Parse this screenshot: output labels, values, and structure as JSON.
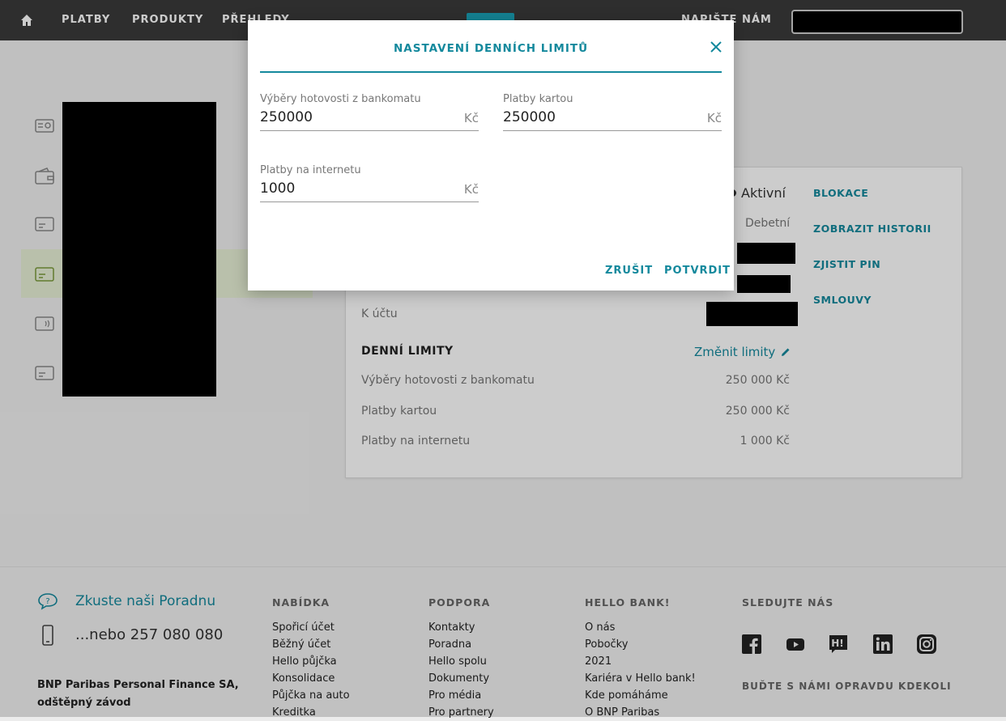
{
  "nav": {
    "items": [
      "PLATBY",
      "PRODUKTY",
      "PŘEHLEDY"
    ],
    "right_label": "NAPIŠTE NÁM"
  },
  "card_panel": {
    "status": "Aktivní",
    "type": "Debetní",
    "account_label": "K účtu",
    "actions": [
      "BLOKACE",
      "ZOBRAZIT HISTORII",
      "ZJISTIT PIN",
      "SMLOUVY"
    ],
    "limits_title": "DENNÍ LIMITY",
    "change_limits": "Změnit limity",
    "limits": [
      {
        "label": "Výběry hotovosti z bankomatu",
        "value": "250 000 Kč"
      },
      {
        "label": "Platby kartou",
        "value": "250 000 Kč"
      },
      {
        "label": "Platby na internetu",
        "value": "1 000 Kč"
      }
    ]
  },
  "modal": {
    "title": "NASTAVENÍ DENNÍCH LIMITŮ",
    "fields": [
      {
        "label": "Výběry hotovosti z bankomatu",
        "value": "250000",
        "unit": "Kč"
      },
      {
        "label": "Platby kartou",
        "value": "250000",
        "unit": "Kč"
      },
      {
        "label": "Platby na internetu",
        "value": "1000",
        "unit": "Kč"
      }
    ],
    "cancel_label": "ZRUŠIT",
    "confirm_label": "POTVRDIT"
  },
  "footer": {
    "help_link": "Zkuste naši Poradnu",
    "phone": "...nebo 257 080 080",
    "company_line1": "BNP Paribas Personal Finance SA,",
    "company_line2": "odštěpný závod",
    "columns": [
      {
        "heading": "NABÍDKA",
        "links": [
          "Spořicí účet",
          "Běžný účet",
          "Hello půjčka",
          "Konsolidace",
          "Půjčka na auto",
          "Kreditka"
        ]
      },
      {
        "heading": "PODPORA",
        "links": [
          "Kontakty",
          "Poradna",
          "Hello spolu",
          "Dokumenty",
          "Pro média",
          "Pro partnery"
        ]
      },
      {
        "heading": "HELLO BANK!",
        "links": [
          "O nás",
          "Pobočky",
          "2021",
          "Kariéra v Hello bank!",
          "Kde pomáháme",
          "O BNP Paribas"
        ]
      }
    ],
    "social_heading": "SLEDUJTE NÁS",
    "social_icons": [
      "facebook-icon",
      "youtube-icon",
      "hello-h-icon",
      "linkedin-icon",
      "instagram-icon"
    ],
    "tagline": "BUĎTE S NÁMI OPRAVDU KDEKOLI"
  },
  "colors": {
    "accent": "#14899d",
    "topbar": "#3a3a3a"
  }
}
